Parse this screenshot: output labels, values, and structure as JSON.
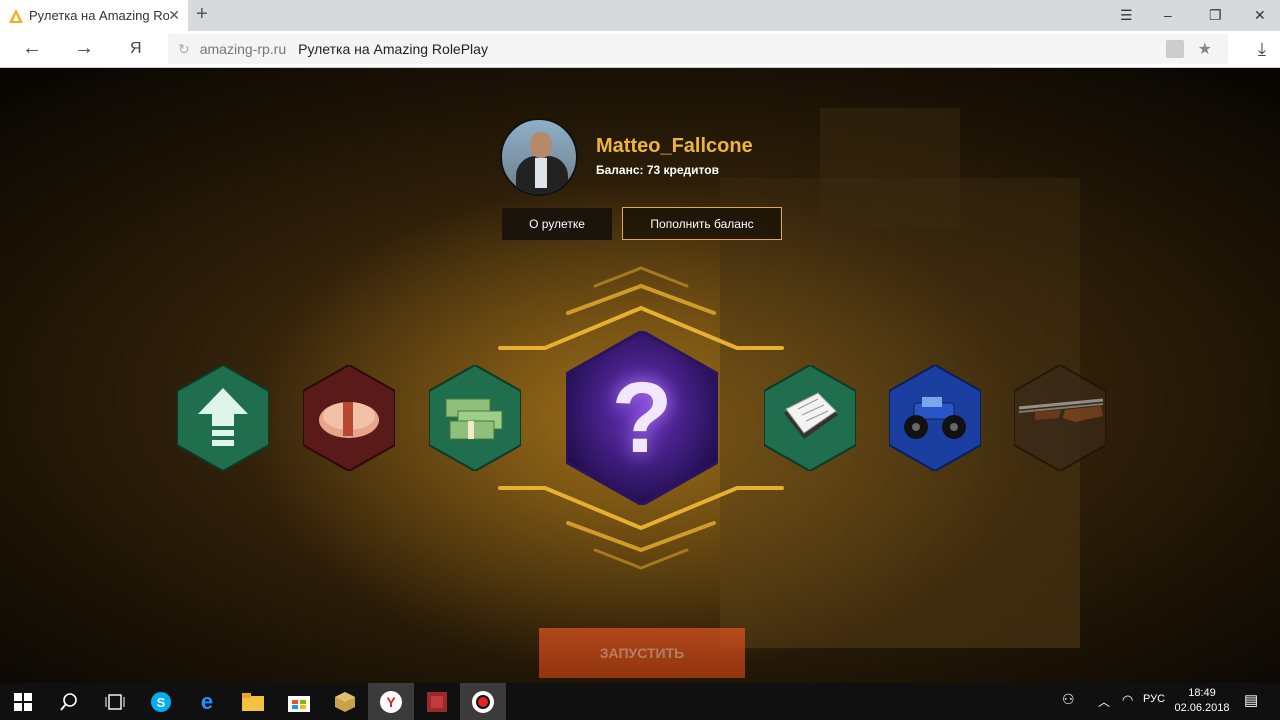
{
  "browser": {
    "tab_title": "Рулетка на Amazing Role",
    "url_domain": "amazing-rp.ru",
    "page_title": "Рулетка на Amazing RolePlay",
    "yandex_glyph": "Я"
  },
  "profile": {
    "username": "Matteo_Fallcone",
    "balance": "Баланс: 73 кредитов"
  },
  "buttons": {
    "about": "О рулетке",
    "topup": "Пополнить баланс",
    "launch": "ЗАПУСТИТЬ"
  },
  "prizes": [
    {
      "name": "level-up-icon",
      "color": "#1f6e4e"
    },
    {
      "name": "rubles-icon",
      "color": "#5a1a1a"
    },
    {
      "name": "dollars-icon",
      "color": "#1f6e4e"
    },
    {
      "name": "mystery-icon",
      "color": "#3a1878"
    },
    {
      "name": "documents-icon",
      "color": "#1f6e4e"
    },
    {
      "name": "monster-truck-icon",
      "color": "#1a3fa0"
    },
    {
      "name": "shotgun-icon",
      "color": "#3a2a18"
    }
  ],
  "taskbar": {
    "lang": "РУС",
    "time": "18:49",
    "date": "02.06.2018"
  }
}
